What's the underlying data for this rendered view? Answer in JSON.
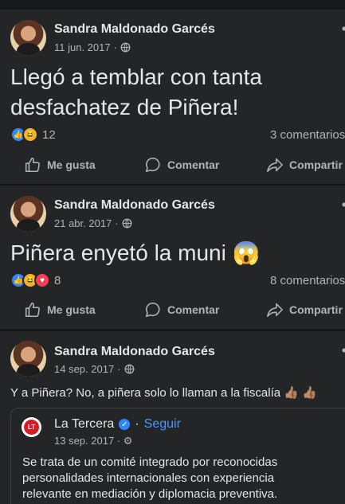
{
  "posts": [
    {
      "author": "Sandra Maldonado Garcés",
      "date": "11 jun. 2017",
      "text": "Llegó a temblar con tanta",
      "text_line2": "desfachatez de Piñera!",
      "reaction_count": "12",
      "comments": "3 comentarios",
      "reactions": [
        "like",
        "haha"
      ]
    },
    {
      "author": "Sandra Maldonado Garcés",
      "date": "21 abr. 2017",
      "text": "Piñera enyetó la muni 😱",
      "reaction_count": "8",
      "comments": "8 comentarios",
      "reactions": [
        "like",
        "haha",
        "love"
      ]
    },
    {
      "author": "Sandra Maldonado Garcés",
      "date": "14 sep. 2017",
      "text": "Y a Piñera? No, a piñera solo lo llaman a la fiscalía 👍🏽 👍🏽",
      "shared": {
        "page": "La Tercera",
        "logo": "LT",
        "follow": "Seguir",
        "date": "13 sep. 2017",
        "body": "Se trata de un comité integrado por reconocidas personalidades internacionales con experiencia relevante en mediación y diplomacia preventiva."
      }
    }
  ],
  "actions": {
    "like": "Me gusta",
    "comment": "Comentar",
    "share": "Compartir"
  },
  "meta_sep": "·",
  "more_glyph": "•",
  "icons": {
    "privacy": "globe-icon",
    "like": "thumbs-up-icon",
    "comment": "comment-bubble-icon",
    "share": "share-arrow-icon"
  },
  "colors": {
    "background": "#18191a",
    "card": "#242526",
    "text": "#e4e6eb",
    "secondary": "#b0b3b8",
    "link": "#4599ff",
    "like": "#2d88ff",
    "haha": "#f7b125",
    "love": "#f33e58",
    "brand_red": "#d01f25"
  }
}
